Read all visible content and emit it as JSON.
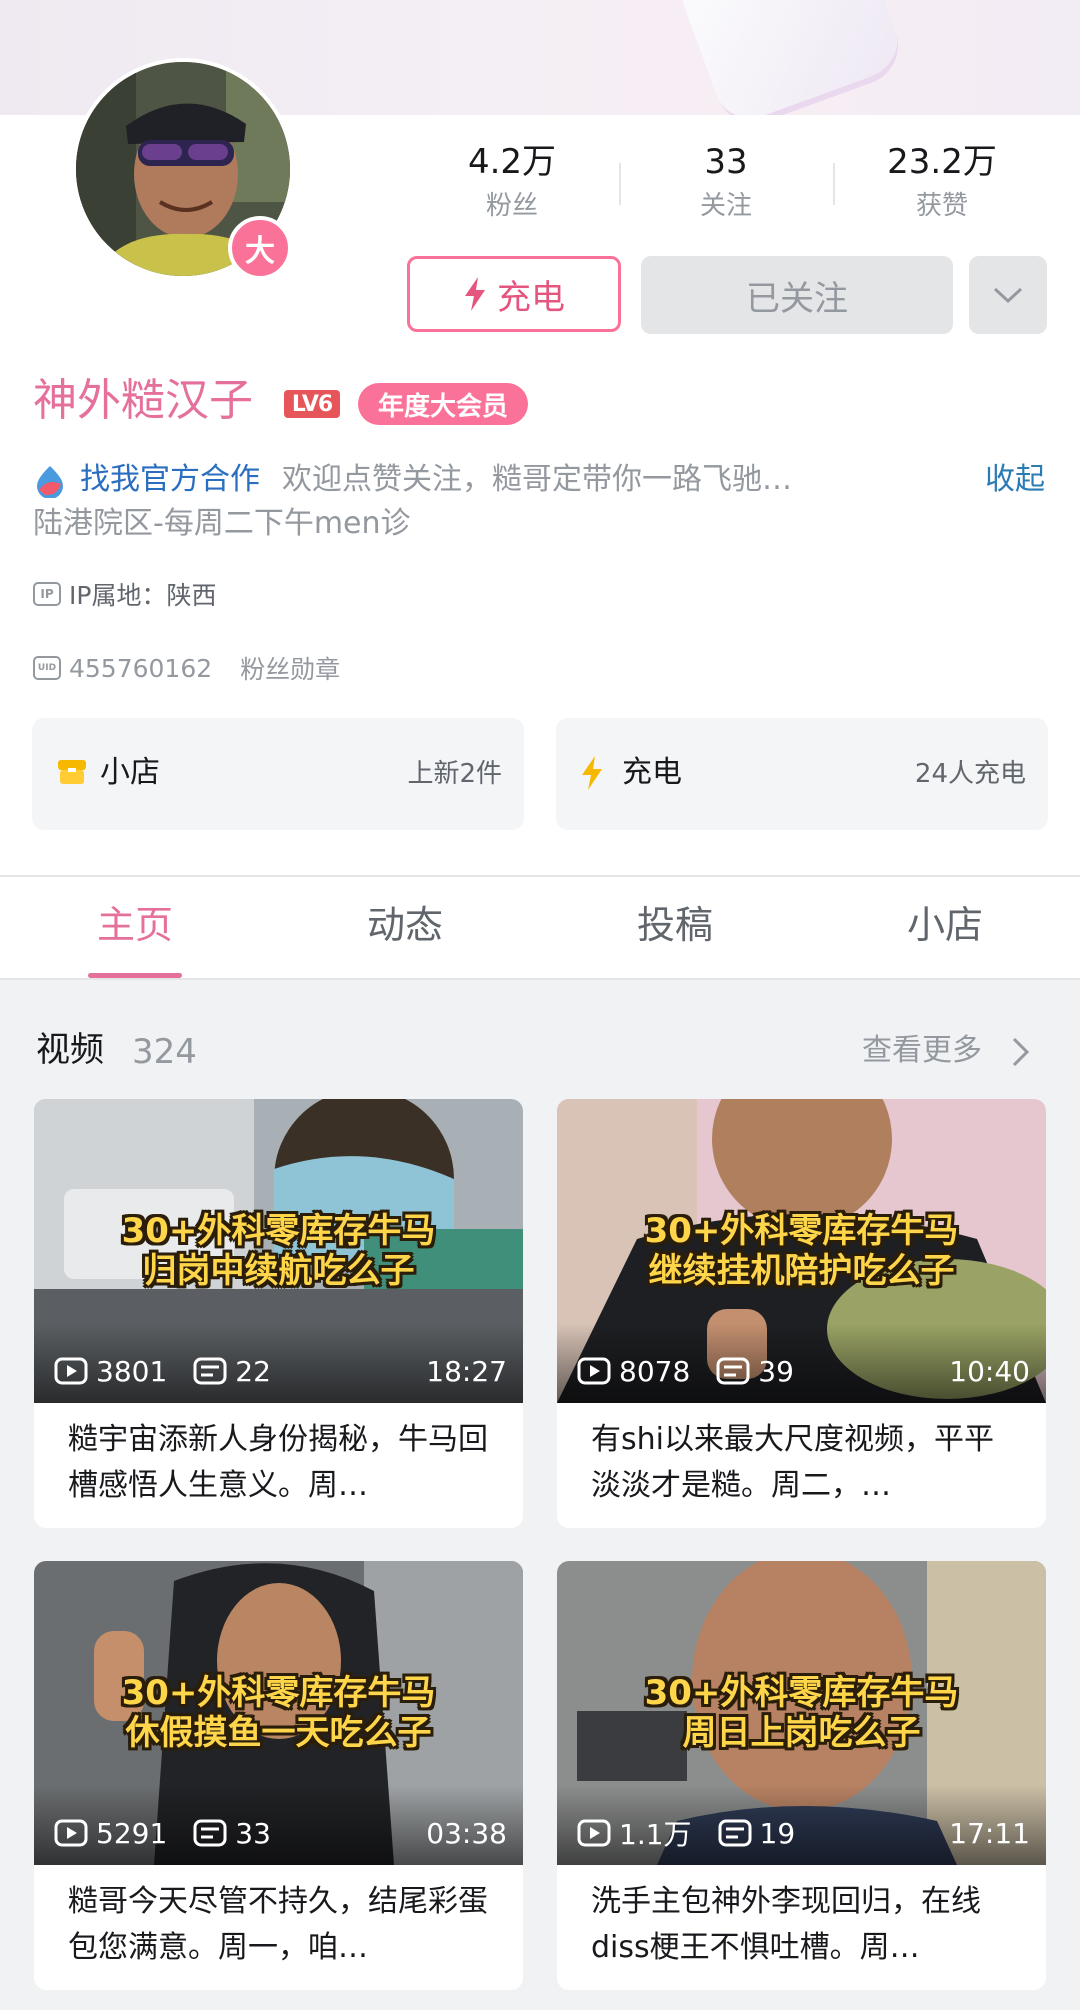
{
  "profile": {
    "name": "神外糙汉子",
    "level": "LV6",
    "vip_badge": "年度大会员",
    "avatar_badge": "大",
    "stats": [
      {
        "value": "4.2万",
        "label": "粉丝"
      },
      {
        "value": "33",
        "label": "关注"
      },
      {
        "value": "23.2万",
        "label": "获赞"
      }
    ],
    "charge_button": "充电",
    "follow_button": "已关注",
    "cooperation_link": "找我官方合作",
    "bio_line1": "欢迎点赞关注，糙哥定带你一路飞驰…",
    "collapse_link": "收起",
    "bio_line2": "陆港院区-每周二下午men诊",
    "ip_location": "IP属地：陕西",
    "ip_icon_text": "IP",
    "uid_icon_text": "UID",
    "uid": "455760162",
    "fan_medal": "粉丝勋章"
  },
  "cards": {
    "shop": {
      "label": "小店",
      "right": "上新2件"
    },
    "charge": {
      "label": "充电",
      "right": "24人充电"
    }
  },
  "tabs": [
    "主页",
    "动态",
    "投稿",
    "小店"
  ],
  "section": {
    "title": "视频",
    "count": "324",
    "see_more": "查看更多"
  },
  "videos": [
    {
      "caption1": "30+外科零库存牛马",
      "caption2": "归岗中续航吃么子",
      "plays": "3801",
      "danmaku": "22",
      "duration": "18:27",
      "title": "糙宇宙添新人身份揭秘，牛马回槽感悟人生意义。周…"
    },
    {
      "caption1": "30+外科零库存牛马",
      "caption2": "继续挂机陪护吃么子",
      "plays": "8078",
      "danmaku": "39",
      "duration": "10:40",
      "title": "有shi以来最大尺度视频，平平淡淡才是糙。周二，…"
    },
    {
      "caption1": "30+外科零库存牛马",
      "caption2": "休假摸鱼一天吃么子",
      "plays": "5291",
      "danmaku": "33",
      "duration": "03:38",
      "title": "糙哥今天尽管不持久，结尾彩蛋包您满意。周一，咱…"
    },
    {
      "caption1": "30+外科零库存牛马",
      "caption2": "周日上岗吃么子",
      "plays": "1.1万",
      "danmaku": "19",
      "duration": "17:11",
      "title": "洗手主包神外李现回归，在线diss梗王不惧吐槽。周…"
    }
  ],
  "colors": {
    "accent_pink": "#fb7299",
    "link_blue": "#2a6ebf"
  }
}
